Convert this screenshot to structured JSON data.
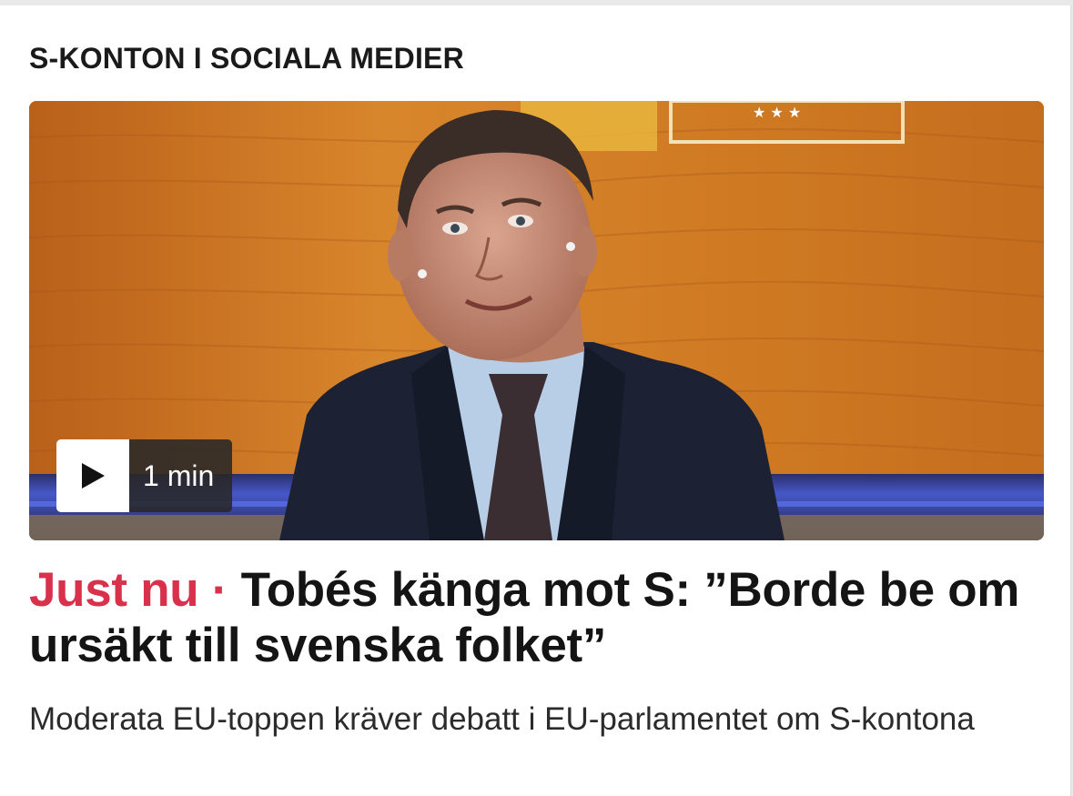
{
  "section": {
    "kicker": "S-KONTON I SOCIALA MEDIER"
  },
  "video": {
    "duration": "1 min",
    "play_icon": "play-icon"
  },
  "article": {
    "live_label": "Just nu",
    "separator": "·",
    "headline": "Tobés känga mot S: ”Borde be om ursäkt till svenska folket”",
    "summary": "Moderata EU-toppen kräver debatt i EU-parlamentet om S-kontona"
  },
  "colors": {
    "live_red": "#d9304c",
    "text": "#141414",
    "background_wood": "#c8741f"
  }
}
